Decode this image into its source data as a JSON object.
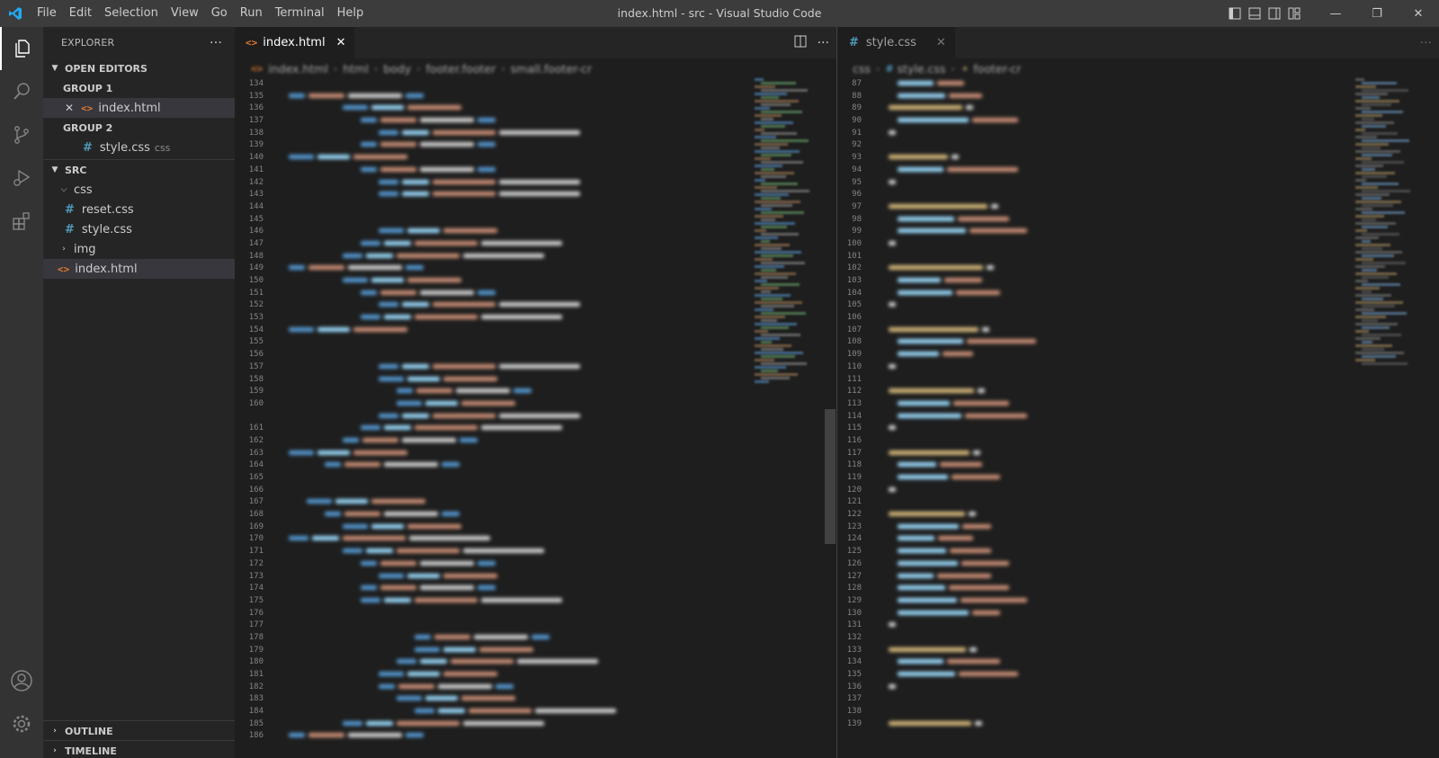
{
  "window": {
    "title": "index.html - src - Visual Studio Code",
    "menu": [
      "File",
      "Edit",
      "Selection",
      "View",
      "Go",
      "Run",
      "Terminal",
      "Help"
    ],
    "controls": {
      "minimize": "—",
      "restore": "❐",
      "close": "✕"
    }
  },
  "activity_bar": {
    "icons": [
      "explorer-icon",
      "search-icon",
      "source-control-icon",
      "run-debug-icon",
      "extensions-icon",
      "account-icon",
      "settings-gear-icon"
    ],
    "active": "explorer-icon"
  },
  "sidebar": {
    "title": "EXPLORER",
    "more": "···",
    "open_editors": {
      "label": "OPEN EDITORS",
      "groups": [
        {
          "label": "GROUP 1",
          "files": [
            {
              "name": "index.html",
              "hint": ""
            }
          ]
        },
        {
          "label": "GROUP 2",
          "files": [
            {
              "name": "style.css",
              "hint": "css"
            }
          ]
        }
      ]
    },
    "folder": {
      "label": "SRC",
      "css_folder": "css",
      "css_files": [
        "reset.css",
        "style.css"
      ],
      "img_folder": "img",
      "index": "index.html"
    },
    "outline": "OUTLINE",
    "timeline": "TIMELINE"
  },
  "editor_left": {
    "tab": "index.html",
    "tab_close": "✕",
    "breadcrumb": [
      "index.html",
      "html",
      "body",
      "footer.footer",
      "small.footer-cr"
    ],
    "line_numbers": [
      "134",
      "135",
      "136",
      "137",
      "138",
      "139",
      "140",
      "141",
      "142",
      "143",
      "144",
      "145",
      "146",
      "147",
      "148",
      "149",
      "150",
      "151",
      "152",
      "153",
      "154",
      "155",
      "156",
      "157",
      "158",
      "159",
      "160",
      "",
      "161",
      "162",
      "163",
      "164",
      "165",
      "166",
      "167",
      "168",
      "169",
      "170",
      "171",
      "172",
      "173",
      "174",
      "175",
      "176",
      "177",
      "178",
      "179",
      "180",
      "181",
      "182",
      "183",
      "184",
      "185",
      "186"
    ]
  },
  "editor_right": {
    "tab": "style.css",
    "tab_close": "✕",
    "breadcrumb": [
      "css",
      "style.css",
      "footer-cr"
    ],
    "line_numbers": [
      "87",
      "88",
      "89",
      "90",
      "91",
      "92",
      "93",
      "94",
      "95",
      "96",
      "97",
      "98",
      "99",
      "100",
      "101",
      "102",
      "103",
      "104",
      "105",
      "106",
      "107",
      "108",
      "109",
      "110",
      "111",
      "112",
      "113",
      "114",
      "115",
      "116",
      "117",
      "118",
      "119",
      "120",
      "121",
      "122",
      "123",
      "124",
      "125",
      "126",
      "127",
      "128",
      "129",
      "130",
      "131",
      "132",
      "133",
      "134",
      "135",
      "136",
      "137",
      "138",
      "139"
    ],
    "visible_code": "justify-content: space-between;"
  },
  "colors": {
    "titlebar": "#3c3c3c",
    "activitybar": "#333333",
    "sidebar": "#252526",
    "editor_bg": "#1e1e1e",
    "html_icon": "#e37933",
    "css_icon": "#519aba",
    "accent": "#0078d4"
  }
}
